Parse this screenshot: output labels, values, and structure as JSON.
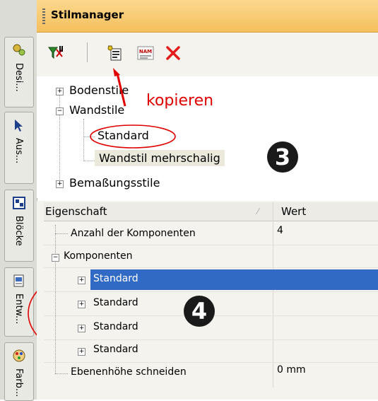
{
  "sidebar": {
    "tabs": [
      {
        "label": "Desi...",
        "icon": "gear-icon"
      },
      {
        "label": "Aus...",
        "icon": "cursor-icon"
      },
      {
        "label": "Blöcke",
        "icon": "blocks-icon"
      },
      {
        "label": "Entw...",
        "icon": "document-icon"
      },
      {
        "label": "Farb...",
        "icon": "palette-icon"
      }
    ]
  },
  "panel": {
    "title": "Stilmanager"
  },
  "toolbar": {
    "buttons": [
      "filter-icon",
      "copy-style-icon",
      "rename-icon",
      "delete-icon"
    ]
  },
  "tree": {
    "items": [
      {
        "label": "Bodenstile",
        "expand": "+"
      },
      {
        "label": "Wandstile",
        "expand": "−"
      },
      {
        "label": "Standard"
      },
      {
        "label": "Wandstil mehrschalig"
      },
      {
        "label": "Bemaßungsstile",
        "expand": "+"
      }
    ]
  },
  "grid": {
    "header_property": "Eigenschaft",
    "header_value": "Wert",
    "rows": [
      {
        "label": "Anzahl der Komponenten",
        "value": "4"
      },
      {
        "label": "Komponenten",
        "expand": "−"
      },
      {
        "label": "Standard",
        "expand": "+"
      },
      {
        "label": "Standard",
        "expand": "+"
      },
      {
        "label": "Standard",
        "expand": "+"
      },
      {
        "label": "Standard",
        "expand": "+"
      },
      {
        "label": "Ebenenhöhe schneiden",
        "value": "0 mm"
      }
    ]
  },
  "annotations": {
    "copy_label": "kopieren",
    "badge_3": "3",
    "badge_4": "4",
    "color": "#e00000"
  }
}
